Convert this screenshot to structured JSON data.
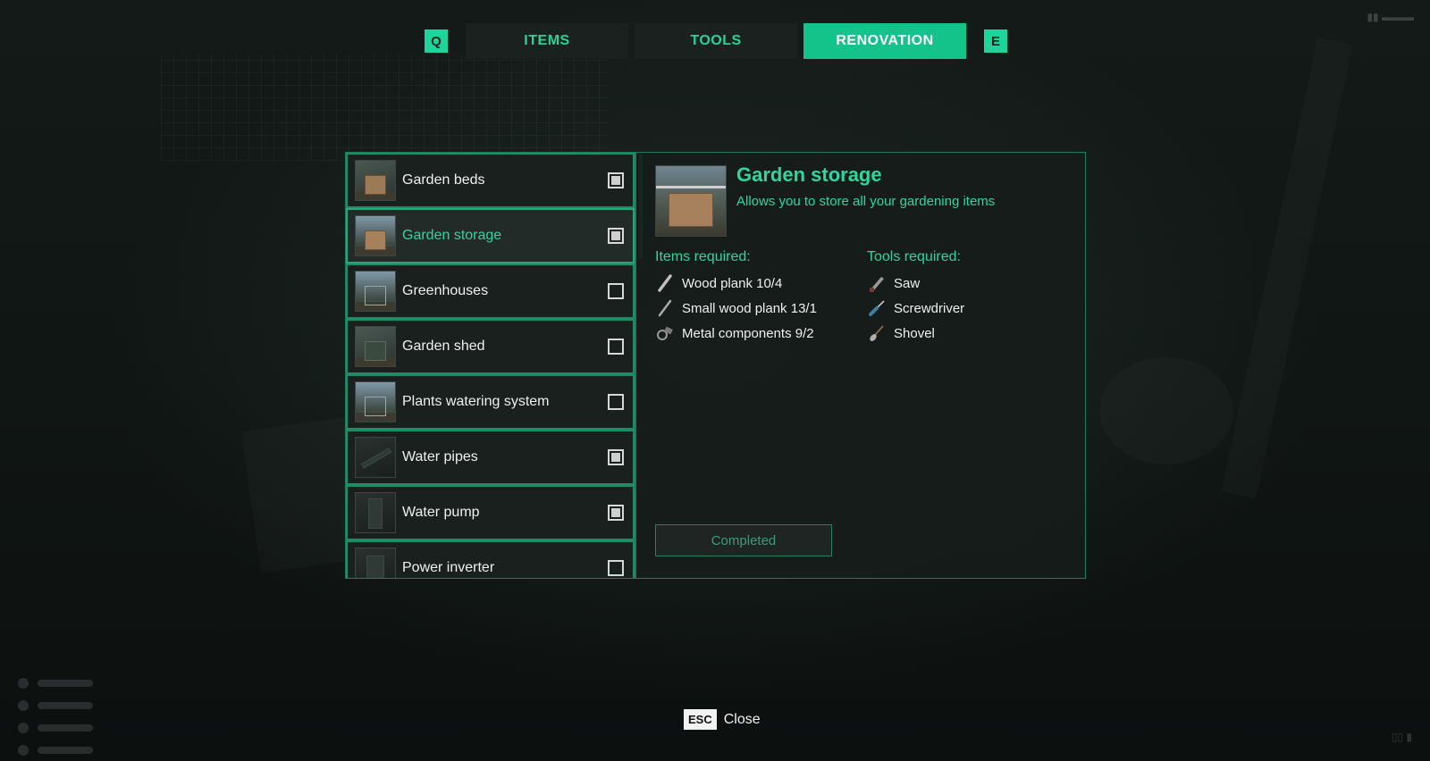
{
  "tabs": {
    "prev_key": "Q",
    "next_key": "E",
    "items": [
      {
        "label": "ITEMS",
        "active": false
      },
      {
        "label": "TOOLS",
        "active": false
      },
      {
        "label": "RENOVATION",
        "active": true
      }
    ]
  },
  "renovation_list": [
    {
      "label": "Garden beds",
      "checked": true,
      "selected": false,
      "thumb": "garden-beds-thumbnail"
    },
    {
      "label": "Garden storage",
      "checked": true,
      "selected": true,
      "thumb": "garden-storage-thumbnail"
    },
    {
      "label": "Greenhouses",
      "checked": false,
      "selected": false,
      "thumb": "greenhouses-thumbnail"
    },
    {
      "label": "Garden shed",
      "checked": false,
      "selected": false,
      "thumb": "garden-shed-thumbnail"
    },
    {
      "label": "Plants watering system",
      "checked": false,
      "selected": false,
      "thumb": "watering-system-thumbnail"
    },
    {
      "label": "Water pipes",
      "checked": true,
      "selected": false,
      "thumb": "water-pipes-thumbnail"
    },
    {
      "label": "Water pump",
      "checked": true,
      "selected": false,
      "thumb": "water-pump-thumbnail"
    },
    {
      "label": "Power inverter",
      "checked": false,
      "selected": false,
      "thumb": "power-inverter-thumbnail"
    }
  ],
  "detail": {
    "title": "Garden storage",
    "description": "Allows you to store all your gardening items",
    "items_heading": "Items required:",
    "tools_heading": "Tools required:",
    "items_required": [
      {
        "label": "Wood plank 10/4",
        "icon": "wood-plank-icon"
      },
      {
        "label": "Small wood plank 13/1",
        "icon": "small-wood-plank-icon"
      },
      {
        "label": "Metal components 9/2",
        "icon": "metal-components-icon"
      }
    ],
    "tools_required": [
      {
        "label": "Saw",
        "icon": "saw-icon"
      },
      {
        "label": "Screwdriver",
        "icon": "screwdriver-icon"
      },
      {
        "label": "Shovel",
        "icon": "shovel-icon"
      }
    ],
    "status_button": "Completed"
  },
  "footer": {
    "close_key": "ESC",
    "close_label": "Close"
  },
  "colors": {
    "accent": "#1ed49a",
    "accent_text": "#2fd69f",
    "panel_border": "#1f7d5e"
  }
}
